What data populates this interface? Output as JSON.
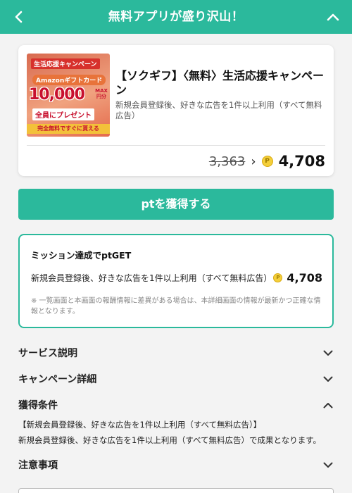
{
  "header": {
    "title": "無料アプリが盛り沢山！",
    "back_icon": "chevron-left-icon",
    "collapse_icon": "chevron-up-icon",
    "bg_color": "#2bb99c"
  },
  "offer": {
    "title": "【ソクギフ】〈無料〉生活応援キャンペーン",
    "description": "新規会員登録後、好きな広告を1件以上利用（すべて無料広告）",
    "old_points": "3,363",
    "new_points": "4,708",
    "coin_symbol": "P",
    "banner": {
      "top": "生活応援キャンペーン",
      "amazon": "Amazonギフトカード",
      "amount": "10,000",
      "max": "MAX円分",
      "gift": "全員にプレゼント",
      "bottom": "完全無料ですぐに貰える"
    }
  },
  "pt_button": {
    "label": "ptを獲得する"
  },
  "mission": {
    "title": "ミッション達成でptGET",
    "task": "新規会員登録後、好きな広告を1件以上利用（すべて無料広告）",
    "points": "4,708",
    "note": "※ 一覧画面と本画面の報酬情報に差異がある場合は、本詳細画面の情報が最新かつ正確な情報となります。"
  },
  "sections": [
    {
      "label": "サービス説明",
      "state": "collapsed"
    },
    {
      "label": "キャンペーン詳細",
      "state": "collapsed"
    },
    {
      "label": "獲得条件",
      "state": "expanded"
    },
    {
      "label": "注意事項",
      "state": "collapsed"
    }
  ],
  "conditions": {
    "line1": "【新規会員登録後、好きな広告を1件以上利用（すべて無料広告）】",
    "line2": "新規会員登録後、好きな広告を1件以上利用（すべて無料広告）で成果となります。"
  }
}
